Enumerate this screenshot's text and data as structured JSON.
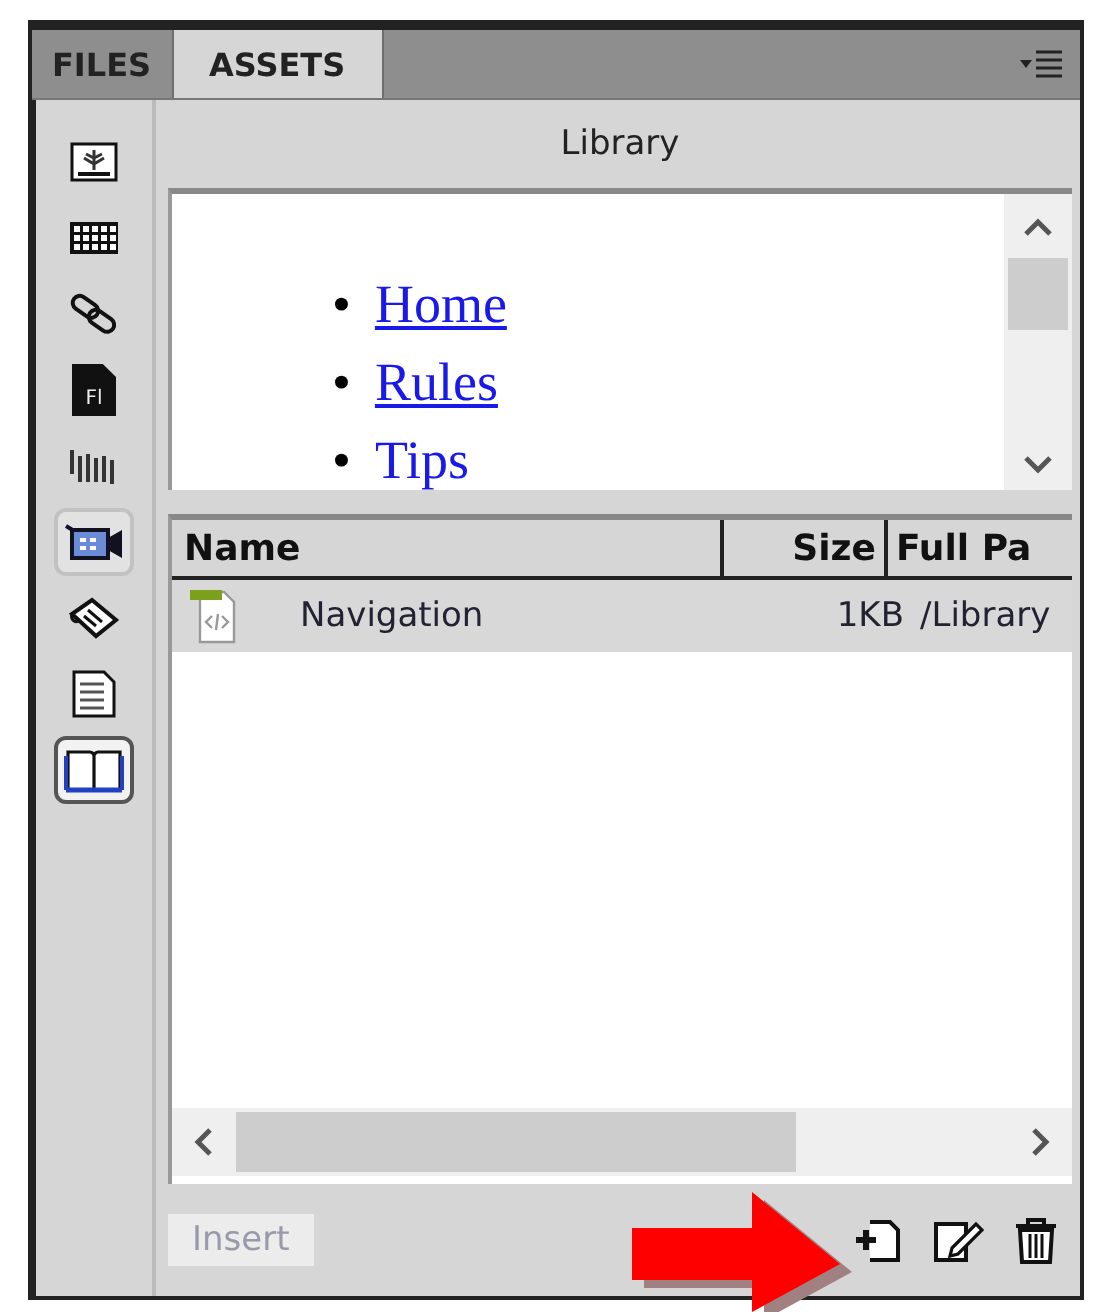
{
  "tabs": [
    {
      "label": "FILES",
      "selected": false
    },
    {
      "label": "ASSETS",
      "selected": true
    }
  ],
  "categories": [
    {
      "kind": "image",
      "selected": false,
      "hovered": false
    },
    {
      "kind": "colors",
      "selected": false,
      "hovered": false
    },
    {
      "kind": "links",
      "selected": false,
      "hovered": false
    },
    {
      "kind": "flash",
      "label": "Fl",
      "selected": false,
      "hovered": false
    },
    {
      "kind": "shockwave",
      "selected": false,
      "hovered": false
    },
    {
      "kind": "movie",
      "selected": false,
      "hovered": true
    },
    {
      "kind": "scripts",
      "selected": false,
      "hovered": false
    },
    {
      "kind": "templates",
      "selected": false,
      "hovered": false
    },
    {
      "kind": "library",
      "selected": true,
      "hovered": false
    }
  ],
  "section_title": "Library",
  "preview": [
    {
      "bullet": "•",
      "text": "Home",
      "underlined": true
    },
    {
      "bullet": "•",
      "text": "Rules",
      "underlined": true
    },
    {
      "bullet": "•",
      "text": "Tips",
      "underlined": false
    }
  ],
  "table": {
    "columns": [
      "Name",
      "Size",
      "Full Pa"
    ],
    "rows": [
      {
        "name": "Navigation",
        "size": "1KB",
        "path": "/Library",
        "selected": true
      }
    ]
  },
  "footer": {
    "insert": "Insert",
    "insert_disabled": true
  }
}
